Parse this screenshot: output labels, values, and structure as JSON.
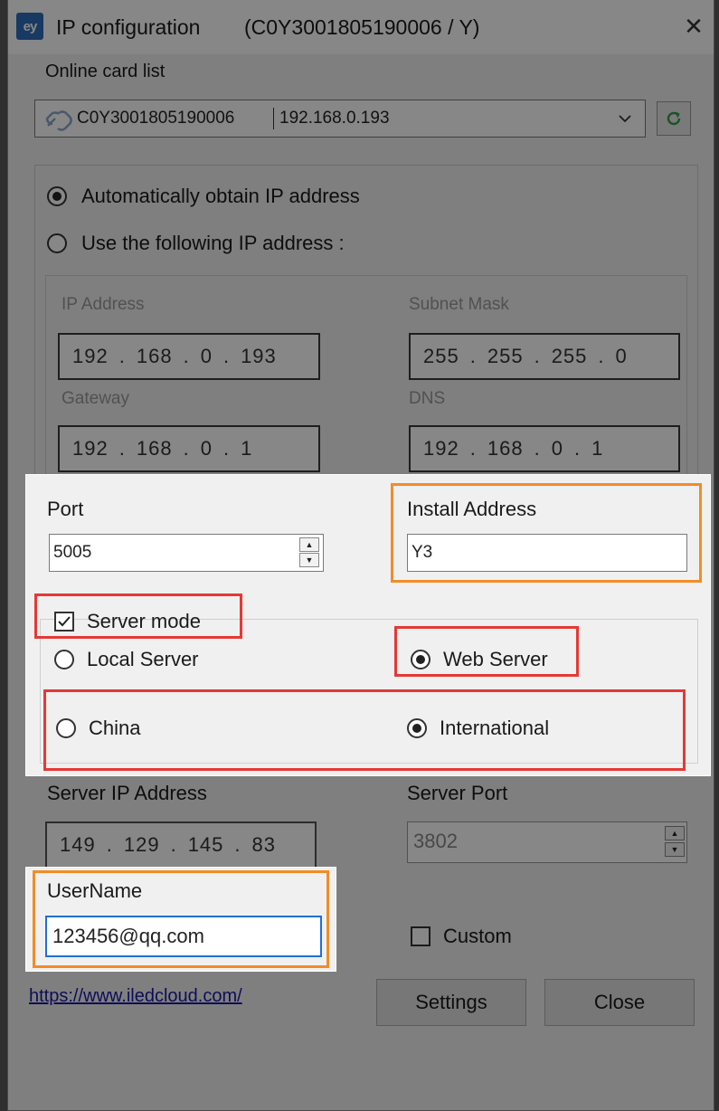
{
  "window": {
    "title": "IP configuration",
    "card_id": "(C0Y3001805190006 / Y)",
    "close_glyph": "✕"
  },
  "card_list": {
    "label": "Online card list",
    "selected_card": "C0Y3001805190006",
    "selected_ip": "192.168.0.193"
  },
  "ip_mode": {
    "auto_label": "Automatically obtain IP address",
    "manual_label": "Use the following IP address :",
    "auto_selected": true
  },
  "ip_fields": {
    "ip_label": "IP Address",
    "ip": [
      "192",
      "168",
      "0",
      "193"
    ],
    "mask_label": "Subnet Mask",
    "mask": [
      "255",
      "255",
      "255",
      "0"
    ],
    "gateway_label": "Gateway",
    "gateway": [
      "192",
      "168",
      "0",
      "1"
    ],
    "dns_label": "DNS",
    "dns": [
      "192",
      "168",
      "0",
      "1"
    ]
  },
  "port": {
    "label": "Port",
    "value": "5005"
  },
  "install_address": {
    "label": "Install Address",
    "value": "Y3"
  },
  "server_mode": {
    "label": "Server mode",
    "checked": true,
    "local_label": "Local Server",
    "web_label": "Web Server",
    "web_selected": true,
    "china_label": "China",
    "international_label": "International",
    "international_selected": true
  },
  "server": {
    "ip_label": "Server IP Address",
    "ip": [
      "149",
      "129",
      "145",
      "83"
    ],
    "port_label": "Server Port",
    "port_value": "3802"
  },
  "username": {
    "label": "UserName",
    "value": "123456@qq.com"
  },
  "custom": {
    "label": "Custom",
    "checked": false
  },
  "footer": {
    "link": "https://www.iledcloud.com/",
    "settings_label": "Settings",
    "close_label": "Close"
  },
  "colors": {
    "highlight_red": "#e53935",
    "highlight_orange": "#f28c28",
    "app_icon": "#2f6db8",
    "refresh_icon": "#2e9e4a",
    "link": "#1a1aa6"
  }
}
